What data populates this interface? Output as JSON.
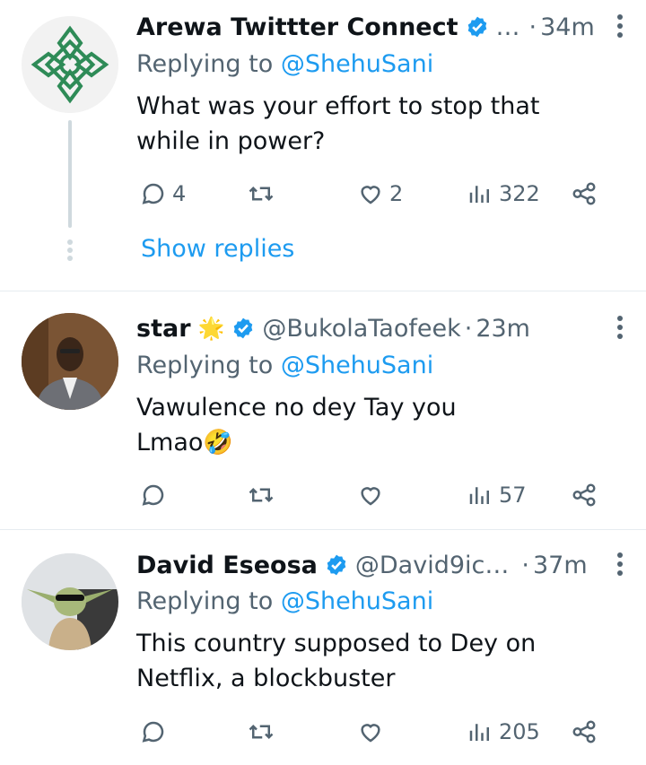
{
  "tweets": [
    {
      "name": "Arewa Twittter Connect",
      "handle": "…",
      "time": "34m",
      "replying_prefix": "Replying to ",
      "replying_to": "@ShehuSani",
      "text": "What was your effort to stop that while in power?",
      "replies": "4",
      "retweets": "",
      "likes": "2",
      "views": "322",
      "show_replies": "Show replies"
    },
    {
      "name": "star",
      "name_emoji": "🌟",
      "handle": "@BukolaTaofeek",
      "time": "23m",
      "replying_prefix": "Replying to ",
      "replying_to": "@ShehuSani",
      "text_line1": "Vawulence no dey Tay you",
      "text_line2": "Lmao🤣",
      "replies": "",
      "retweets": "",
      "likes": "",
      "views": "57"
    },
    {
      "name": "David Eseosa",
      "handle": "@David9ic…",
      "time": "37m",
      "replying_prefix": "Replying to ",
      "replying_to": "@ShehuSani",
      "text": "This country supposed to Dey on Netflix, a blockbuster",
      "replies": "",
      "retweets": "",
      "likes": "",
      "views": "205"
    }
  ],
  "separator": "·",
  "colors": {
    "accent": "#1d9bf0",
    "muted": "#536471",
    "verified": "#1d9bf0"
  },
  "icons": [
    "reply-icon",
    "retweet-icon",
    "like-icon",
    "views-icon",
    "share-icon",
    "verified-badge-icon",
    "more-icon"
  ]
}
